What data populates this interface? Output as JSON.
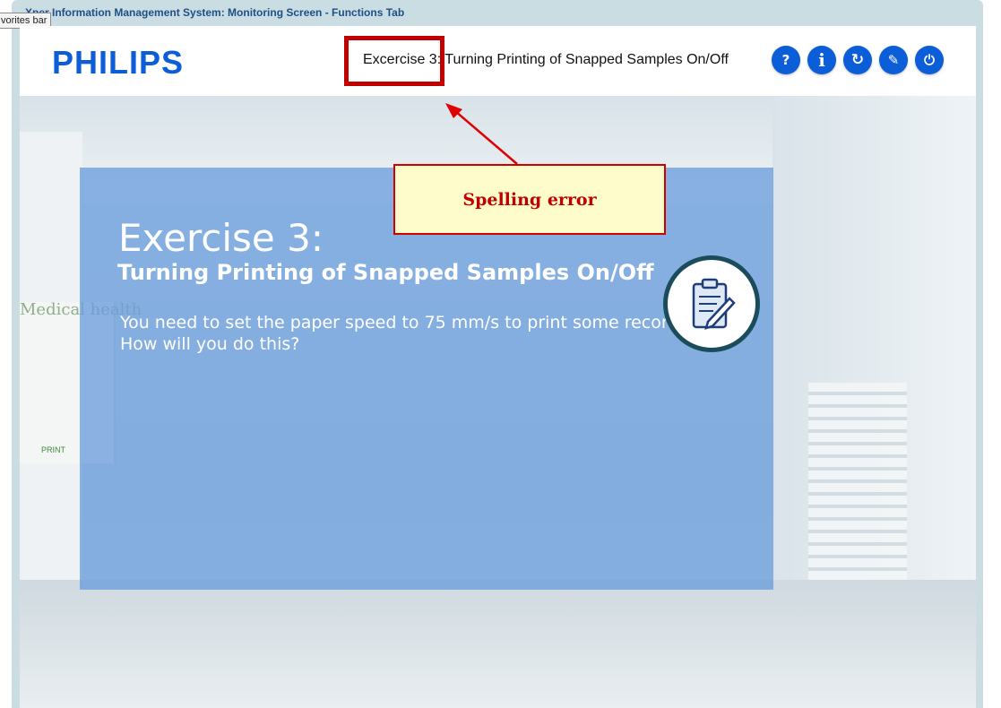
{
  "window": {
    "title": "Xper Information Management System: Monitoring Screen - Functions Tab",
    "tooltip": "vorites bar"
  },
  "header": {
    "logo": "PHILIPS",
    "title": "Excercise 3: Turning Printing of Snapped Samples On/Off",
    "buttons": [
      {
        "label": "?",
        "icon": "help-icon"
      },
      {
        "label": "i",
        "icon": "info-icon"
      },
      {
        "label": "↻",
        "icon": "refresh-icon"
      },
      {
        "label": "✎",
        "icon": "pen-icon"
      },
      {
        "label": "⏻",
        "icon": "power-icon"
      }
    ]
  },
  "exercise": {
    "title": "Exercise 3:",
    "subtitle": "Turning Printing of Snapped Samples On/Off",
    "body": "You need to set the paper speed to 75 mm/s to print some records. How will you do this?",
    "badge_icon": "clipboard-icon"
  },
  "annotation": {
    "callout": "Spelling error",
    "color": "#c00000"
  },
  "background": {
    "poster": "Medical health",
    "poster_label": "PRINT"
  }
}
